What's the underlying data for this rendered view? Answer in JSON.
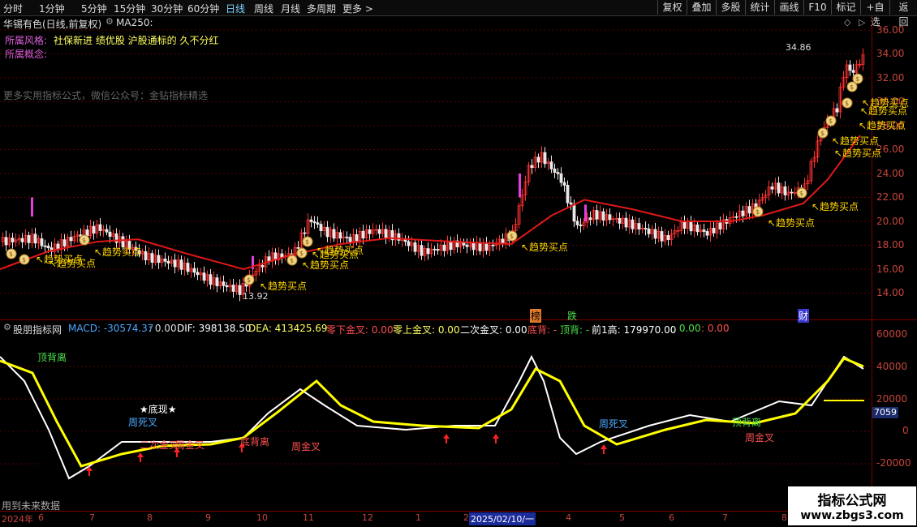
{
  "toolbar": {
    "periods": [
      "分时",
      "1分钟",
      "5分钟",
      "15分钟",
      "30分钟",
      "60分钟",
      "日线",
      "周线",
      "月线",
      "多周期",
      "更多 >"
    ],
    "buttons": [
      "复权",
      "叠加",
      "多股",
      "统计",
      "画线",
      "F10",
      "标记",
      "+自选",
      "返回"
    ]
  },
  "header": {
    "stock_title": "华锡有色(日线,前复权)",
    "ma_label": "MA250:",
    "style_label": "所属风格:",
    "style_value": "社保新进 绩优股 沪股通标的 久不分红",
    "concept_label": "所属概念:",
    "promo_text": "更多实用指标公式，微信公众号：金钻指标精选"
  },
  "main_chart": {
    "y_ticks": [
      "36.00",
      "34.00",
      "32.00",
      "30.00",
      "28.00",
      "26.00",
      "24.00",
      "22.00",
      "20.00",
      "18.00",
      "16.00",
      "14.00"
    ],
    "high_label": "34.86",
    "low_label": "13.92",
    "signal_text": "趋势买点",
    "markers": [
      "榜",
      "跌",
      "财"
    ]
  },
  "sub_chart": {
    "title": "股朋指标网",
    "macd_label": "MACD: -30574.37",
    "zero1": ": 0.00",
    "dif": "DIF: 398138.50",
    "dea": "DEA: 413425.69",
    "zero_down_cross": "零下金叉: 0.00",
    "zero_up_cross": "零上金叉: 0.00",
    "second_cross": "二次金叉: 0.00",
    "bottom_div": "底背: -",
    "top_div": "顶背: -",
    "prev_high": "前1高: 179970.00",
    "v1": ": 0.00",
    "v2": ": 0.00",
    "y_ticks": [
      "60000",
      "40000",
      "20000",
      "0",
      "-20000"
    ],
    "current_value": "7059",
    "annotations": {
      "top_divergence": "顶背离",
      "bottom_appears": "★底现★",
      "zhou_si_cha": "周死叉",
      "zhou_jin_cha": "周金叉",
      "er_ci_jin_cha": "二次金叉",
      "di_bei_li": "底背离"
    },
    "footer_text": "用到未来数据"
  },
  "x_axis": {
    "labels": [
      "2024年",
      "6",
      "7",
      "8",
      "9",
      "10",
      "11",
      "12",
      "1",
      "2",
      "2025/02/10/一",
      "4",
      "5",
      "6",
      "7",
      "8"
    ]
  },
  "watermark": {
    "line1": "指标公式网",
    "line2": "www.zbgs3.com"
  },
  "colors": {
    "ma_line": "#e01818",
    "dif_line": "#ffffff",
    "dea_line": "#ffff00",
    "axis_red": "#c8453a",
    "buy_signal": "#ffd400"
  }
}
